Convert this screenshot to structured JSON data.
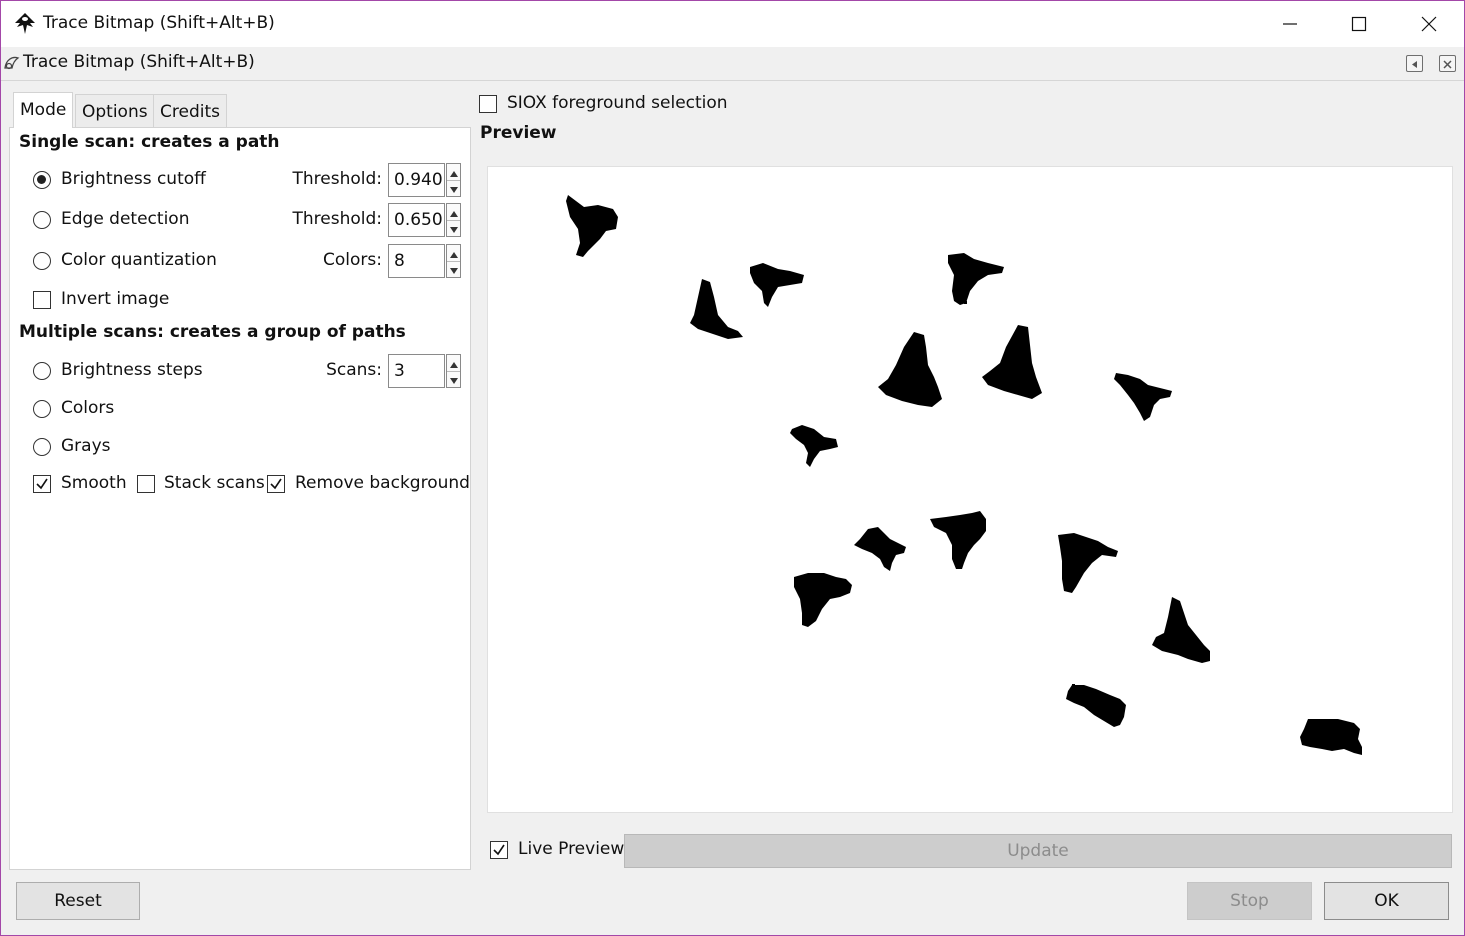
{
  "window": {
    "title": "Trace Bitmap (Shift+Alt+B)",
    "controls": {
      "minimize": "minimize-icon",
      "maximize": "maximize-icon",
      "close": "close-icon"
    }
  },
  "dock": {
    "title": "Trace Bitmap (Shift+Alt+B)"
  },
  "tabs": [
    {
      "label": "Mode",
      "active": true
    },
    {
      "label": "Options",
      "active": false
    },
    {
      "label": "Credits",
      "active": false
    }
  ],
  "mode": {
    "single_scan_title": "Single scan: creates a path",
    "brightness_cutoff": {
      "label": "Brightness cutoff",
      "selected": true,
      "field_label": "Threshold:",
      "value": "0.940"
    },
    "edge_detection": {
      "label": "Edge detection",
      "selected": false,
      "field_label": "Threshold:",
      "value": "0.650"
    },
    "color_quantization": {
      "label": "Color quantization",
      "selected": false,
      "field_label": "Colors:",
      "value": "8"
    },
    "invert_image": {
      "label": "Invert image",
      "checked": false
    },
    "multiple_scans_title": "Multiple scans: creates a group of paths",
    "brightness_steps": {
      "label": "Brightness steps",
      "selected": false,
      "field_label": "Scans:",
      "value": "3"
    },
    "colors": {
      "label": "Colors",
      "selected": false
    },
    "grays": {
      "label": "Grays",
      "selected": false
    },
    "smooth": {
      "label": "Smooth",
      "checked": true
    },
    "stack_scans": {
      "label": "Stack scans",
      "checked": false
    },
    "remove_background": {
      "label": "Remove background",
      "checked": true
    }
  },
  "siox": {
    "label": "SIOX foreground selection",
    "checked": false
  },
  "preview": {
    "title": "Preview",
    "live_preview": {
      "label": "Live Preview",
      "checked": true
    },
    "update_label": "Update"
  },
  "buttons": {
    "reset": "Reset",
    "stop": "Stop",
    "ok": "OK"
  }
}
